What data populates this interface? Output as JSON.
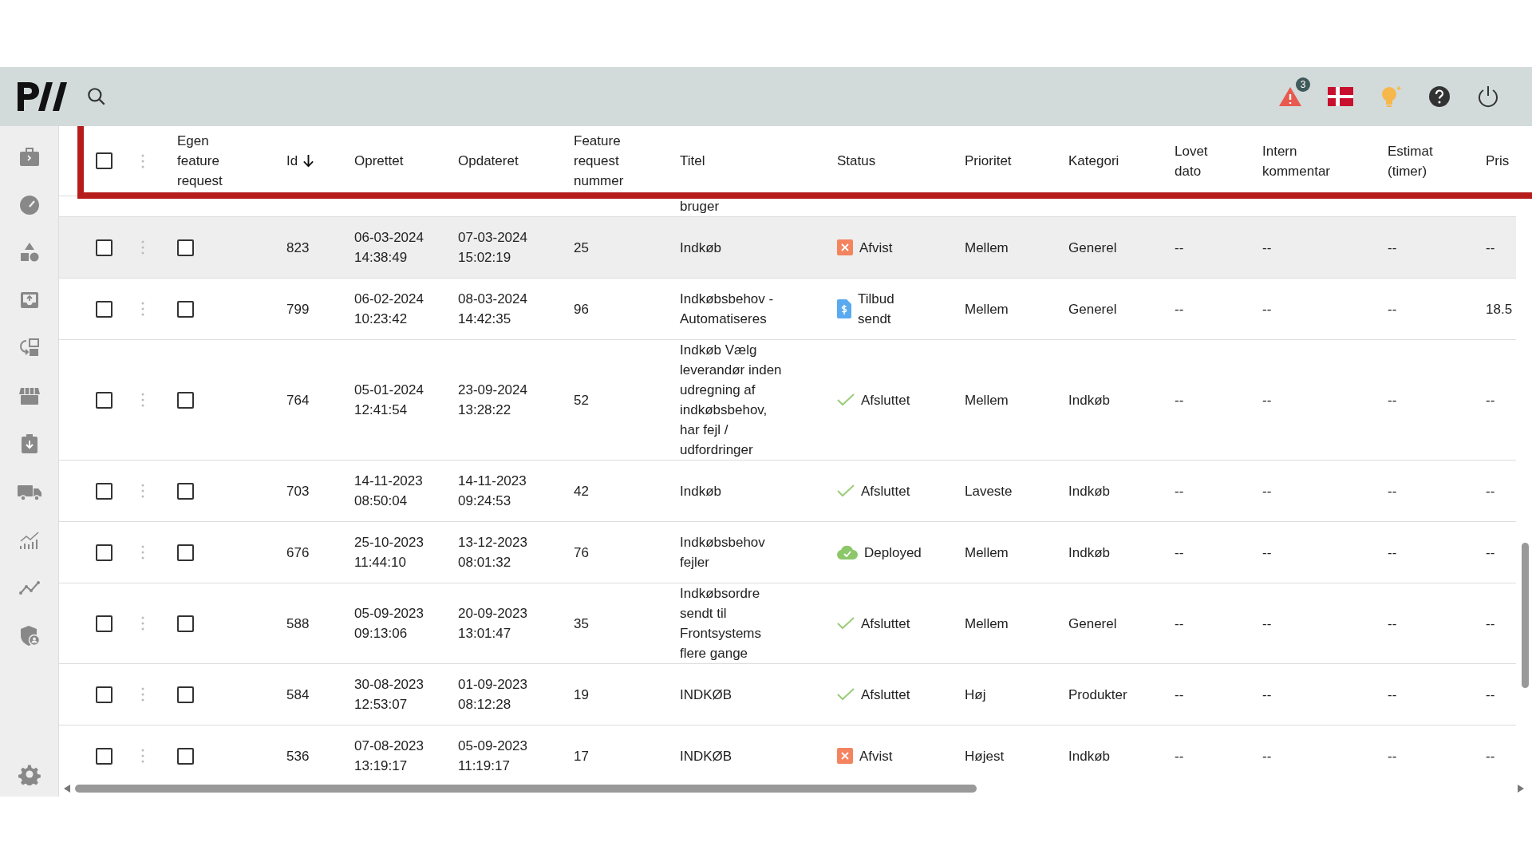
{
  "topbar": {
    "alert_count": "3"
  },
  "table": {
    "select_all": {
      "checked": false
    },
    "columns": [
      {
        "label": "Egen feature request",
        "sorted": false
      },
      {
        "label": "Id",
        "sorted": true
      },
      {
        "label": "Oprettet",
        "sorted": false
      },
      {
        "label": "Opdateret",
        "sorted": false
      },
      {
        "label": "Feature request nummer",
        "sorted": false
      },
      {
        "label": "Titel",
        "sorted": false
      },
      {
        "label": "Status",
        "sorted": false
      },
      {
        "label": "Prioritet",
        "sorted": false
      },
      {
        "label": "Kategori",
        "sorted": false
      },
      {
        "label": "Lovet dato",
        "sorted": false
      },
      {
        "label": "Intern kommentar",
        "sorted": false
      },
      {
        "label": "Estimat (timer)",
        "sorted": false
      },
      {
        "label": "Pris",
        "sorted": false
      }
    ],
    "clipped_row_title": "bruger",
    "rows": [
      {
        "checked": false,
        "highlighted": true,
        "own": false,
        "id": "823",
        "created": "06-03-2024 14:38:49",
        "updated": "07-03-2024 15:02:19",
        "number": "25",
        "title": "Indkøb",
        "status": {
          "kind": "rejected",
          "label": "Afvist"
        },
        "priority": "Mellem",
        "category": "Generel",
        "promised": "--",
        "comment": "--",
        "estimate": "--",
        "price": "--"
      },
      {
        "checked": false,
        "highlighted": false,
        "own": false,
        "id": "799",
        "created": "06-02-2024 10:23:42",
        "updated": "08-03-2024 14:42:35",
        "number": "96",
        "title": "Indkøbsbehov - Automatiseres",
        "status": {
          "kind": "quote",
          "label": "Tilbud sendt"
        },
        "priority": "Mellem",
        "category": "Generel",
        "promised": "--",
        "comment": "--",
        "estimate": "--",
        "price": "18.5"
      },
      {
        "checked": false,
        "highlighted": false,
        "own": false,
        "id": "764",
        "created": "05-01-2024 12:41:54",
        "updated": "23-09-2024 13:28:22",
        "number": "52",
        "title": "Indkøb Vælg leverandør inden udregning af indkøbsbehov, har fejl / udfordringer",
        "status": {
          "kind": "done",
          "label": "Afsluttet"
        },
        "priority": "Mellem",
        "category": "Indkøb",
        "promised": "--",
        "comment": "--",
        "estimate": "--",
        "price": "--"
      },
      {
        "checked": false,
        "highlighted": false,
        "own": false,
        "id": "703",
        "created": "14-11-2023 08:50:04",
        "updated": "14-11-2023 09:24:53",
        "number": "42",
        "title": "Indkøb",
        "status": {
          "kind": "done",
          "label": "Afsluttet"
        },
        "priority": "Laveste",
        "category": "Indkøb",
        "promised": "--",
        "comment": "--",
        "estimate": "--",
        "price": "--"
      },
      {
        "checked": false,
        "highlighted": false,
        "own": false,
        "id": "676",
        "created": "25-10-2023 11:44:10",
        "updated": "13-12-2023 08:01:32",
        "number": "76",
        "title": "Indkøbsbehov fejler",
        "status": {
          "kind": "deployed",
          "label": "Deployed"
        },
        "priority": "Mellem",
        "category": "Indkøb",
        "promised": "--",
        "comment": "--",
        "estimate": "--",
        "price": "--"
      },
      {
        "checked": false,
        "highlighted": false,
        "own": false,
        "id": "588",
        "created": "05-09-2023 09:13:06",
        "updated": "20-09-2023 13:01:47",
        "number": "35",
        "title": "Indkøbsordre sendt til Frontsystems flere gange",
        "status": {
          "kind": "done",
          "label": "Afsluttet"
        },
        "priority": "Mellem",
        "category": "Generel",
        "promised": "--",
        "comment": "--",
        "estimate": "--",
        "price": "--"
      },
      {
        "checked": false,
        "highlighted": false,
        "own": false,
        "id": "584",
        "created": "30-08-2023 12:53:07",
        "updated": "01-09-2023 08:12:28",
        "number": "19",
        "title": "INDKØB",
        "status": {
          "kind": "done",
          "label": "Afsluttet"
        },
        "priority": "Høj",
        "category": "Produkter",
        "promised": "--",
        "comment": "--",
        "estimate": "--",
        "price": "--"
      },
      {
        "checked": false,
        "highlighted": false,
        "own": false,
        "id": "536",
        "created": "07-08-2023 13:19:17",
        "updated": "05-09-2023 11:19:17",
        "number": "17",
        "title": "INDKØB",
        "status": {
          "kind": "rejected",
          "label": "Afvist"
        },
        "priority": "Højest",
        "category": "Indkøb",
        "promised": "--",
        "comment": "--",
        "estimate": "--",
        "price": "--"
      }
    ]
  }
}
